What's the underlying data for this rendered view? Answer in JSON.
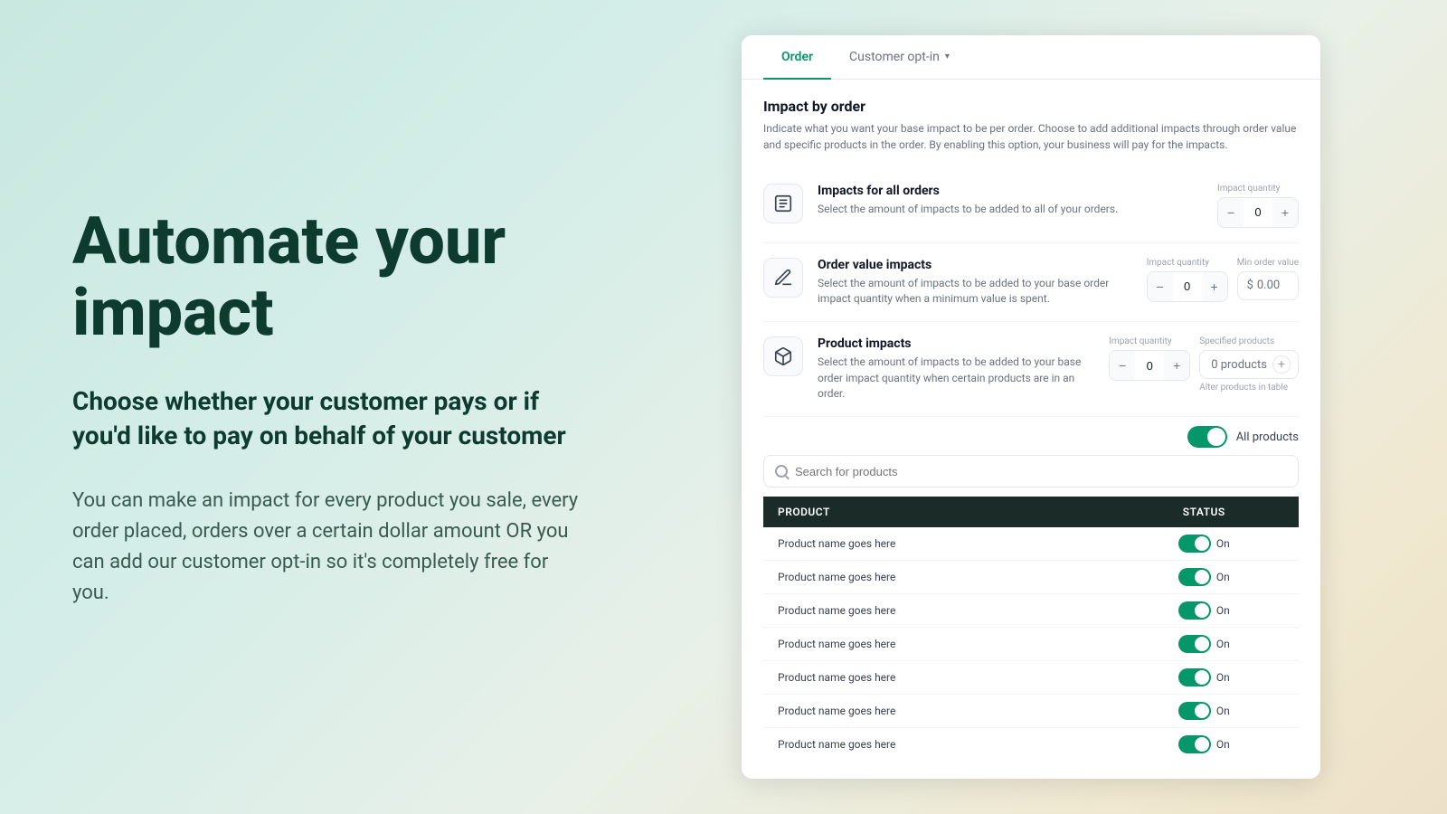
{
  "left": {
    "heading_line1": "Automate your",
    "heading_line2": "impact",
    "sub_heading": "Choose whether your customer pays or if you'd like to pay on behalf of your customer",
    "body_text": "You can make an impact for every product you sale, every order placed, orders over a certain dollar amount OR you can add our customer opt-in so it's completely free for you."
  },
  "card": {
    "tabs": [
      {
        "label": "Order",
        "active": true
      },
      {
        "label": "Customer opt-in",
        "active": false,
        "has_chevron": true
      }
    ],
    "section_title": "Impact by order",
    "section_desc": "Indicate what you want your base impact to be per order. Choose to add additional impacts through order value and specific products in the order. By enabling this option, your business will pay for the impacts.",
    "impact_rows": [
      {
        "icon": "📋",
        "title": "Impacts for all orders",
        "desc": "Select the amount of impacts to be added to all of your orders.",
        "qty_label": "Impact quantity",
        "qty_value": "0",
        "has_min_order": false,
        "has_specified": false
      },
      {
        "icon": "✏️",
        "title": "Order value impacts",
        "desc": "Select the amount of impacts to be added to your base order impact quantity when a minimum value is spent.",
        "qty_label": "Impact quantity",
        "qty_value": "0",
        "has_min_order": true,
        "min_order_label": "Min order value",
        "min_order_symbol": "$",
        "min_order_value": "0.00",
        "has_specified": false
      },
      {
        "icon": "📦",
        "title": "Product impacts",
        "desc": "Select the amount of impacts to be added to your base order impact quantity when certain products are in an order.",
        "qty_label": "Impact quantity",
        "qty_value": "0",
        "has_min_order": false,
        "has_specified": true,
        "specified_label": "Specified products",
        "specified_value": "0 products",
        "alter_hint": "Alter products in table"
      }
    ],
    "all_products_label": "All products",
    "search_placeholder": "Search for products",
    "table": {
      "headers": [
        "PRODUCT",
        "STATUS"
      ],
      "rows": [
        {
          "name": "Product name goes here",
          "status": "On"
        },
        {
          "name": "Product name goes here",
          "status": "On"
        },
        {
          "name": "Product name goes here",
          "status": "On"
        },
        {
          "name": "Product name goes here",
          "status": "On"
        },
        {
          "name": "Product name goes here",
          "status": "On"
        },
        {
          "name": "Product name goes here",
          "status": "On"
        },
        {
          "name": "Product name goes here",
          "status": "On"
        }
      ]
    }
  }
}
